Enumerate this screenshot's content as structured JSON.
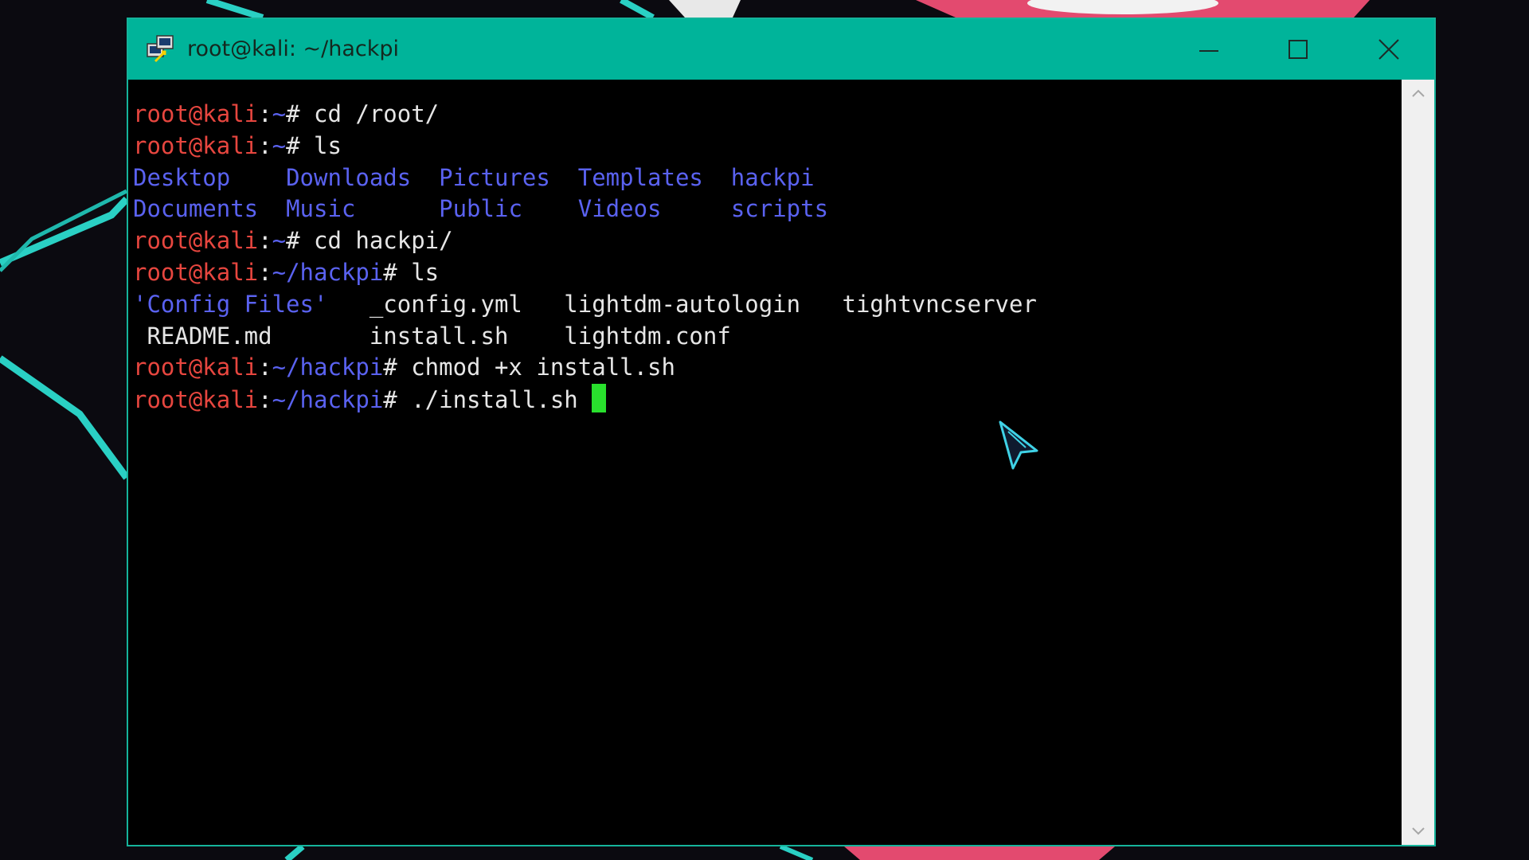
{
  "window": {
    "title": "root@kali: ~/hackpi"
  },
  "terminal": {
    "lines": [
      {
        "kind": "prompt",
        "user": "root@kali",
        "sep": ":",
        "path": "~",
        "hash": "# ",
        "cmd": "cd /root/"
      },
      {
        "kind": "prompt",
        "user": "root@kali",
        "sep": ":",
        "path": "~",
        "hash": "# ",
        "cmd": "ls"
      },
      {
        "kind": "ls",
        "cols": [
          "Desktop",
          "Downloads",
          "Pictures",
          "Templates",
          "hackpi"
        ]
      },
      {
        "kind": "ls",
        "cols": [
          "Documents",
          "Music",
          "Public",
          "Videos",
          "scripts"
        ]
      },
      {
        "kind": "prompt",
        "user": "root@kali",
        "sep": ":",
        "path": "~",
        "hash": "# ",
        "cmd": "cd hackpi/"
      },
      {
        "kind": "prompt",
        "user": "root@kali",
        "sep": ":",
        "path": "~/hackpi",
        "hash": "# ",
        "cmd": "ls"
      },
      {
        "kind": "ls",
        "cols": [
          "'Config Files'",
          "_config.yml",
          "lightdm-autologin",
          "tightvncserver"
        ]
      },
      {
        "kind": "ls",
        "cols": [
          " README.md",
          "install.sh",
          "lightdm.conf"
        ]
      },
      {
        "kind": "prompt",
        "user": "root@kali",
        "sep": ":",
        "path": "~/hackpi",
        "hash": "# ",
        "cmd": "chmod +x install.sh"
      },
      {
        "kind": "prompt",
        "user": "root@kali",
        "sep": ":",
        "path": "~/hackpi",
        "hash": "# ",
        "cmd": "./install.sh "
      }
    ]
  },
  "colors": {
    "titlebar": "#00b49a",
    "prompt_user": "#e7463f",
    "prompt_path": "#5a62f0",
    "directory": "#5a62f0",
    "text": "#e6e6e6",
    "cursor": "#29e02d"
  },
  "icons": {
    "app": "putty-icon",
    "minimize": "minimize-icon",
    "maximize": "maximize-icon",
    "close": "close-icon",
    "scroll_up": "chevron-up-icon",
    "scroll_down": "chevron-down-icon",
    "pointer": "mouse-pointer-icon"
  }
}
